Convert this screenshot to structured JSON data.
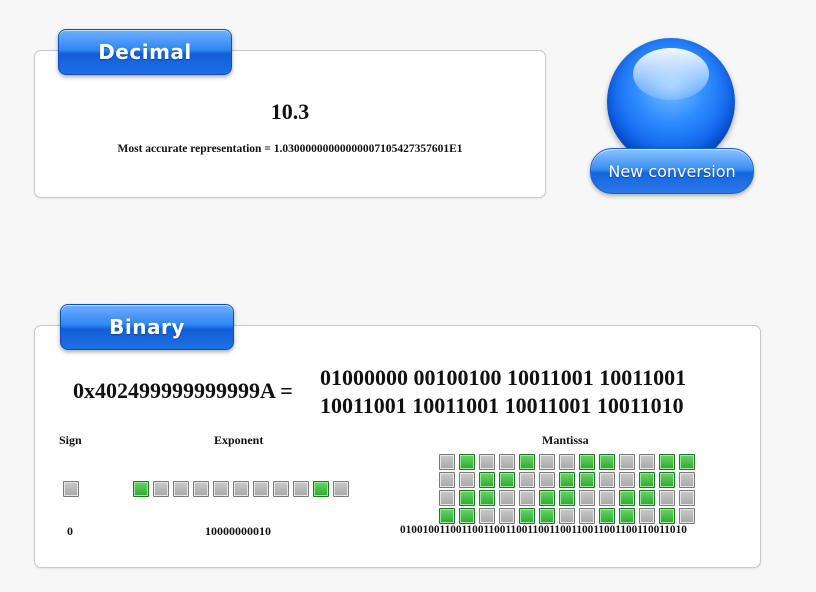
{
  "decimal": {
    "tab_label": "Decimal",
    "value": "10.3",
    "representation": "Most accurate representation = 1.03000000000000007105427357601E1"
  },
  "new_conversion": {
    "label": "New conversion"
  },
  "binary": {
    "tab_label": "Binary",
    "hex": "0x402499999999999A",
    "equals": "=",
    "bits_line1": "01000000 00100100 10011001 10011001",
    "bits_line2": "10011001 10011001 10011001 10011010",
    "sign": {
      "label": "Sign",
      "value": "0"
    },
    "exponent": {
      "label": "Exponent",
      "value": "10000000010"
    },
    "mantissa": {
      "label": "Mantissa",
      "value": "0100100110011001100110011001100110011001100110011010"
    }
  },
  "colors": {
    "bit_on": "#2ea82e",
    "bit_off": "#a7a7a7",
    "accent_blue": "#1f6fe6"
  }
}
